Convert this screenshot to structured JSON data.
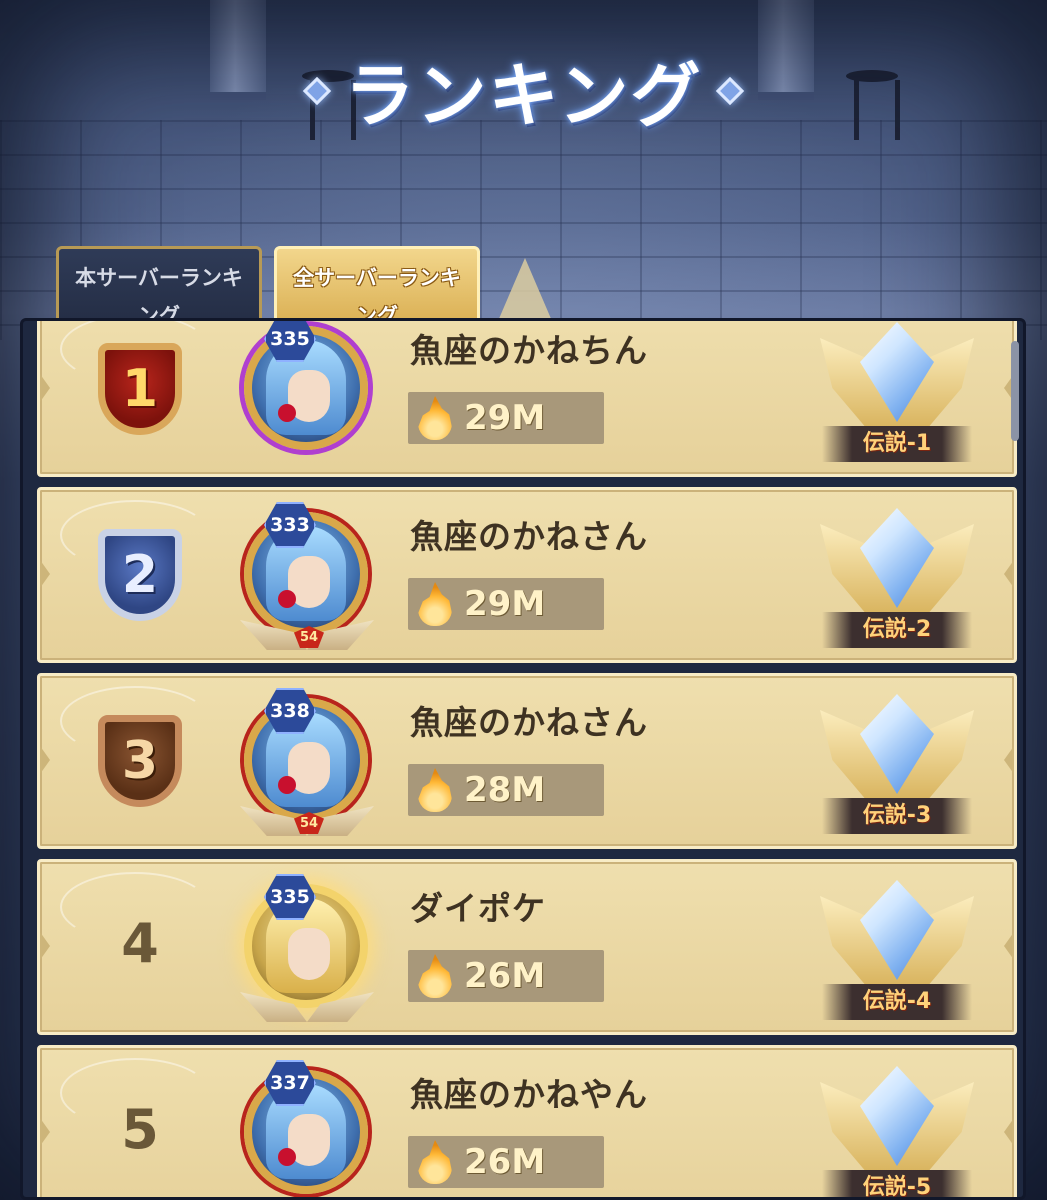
{
  "title": "ランキング",
  "tabs": [
    {
      "label": "本サーバーランキング",
      "active": false
    },
    {
      "label": "全サーバーランキング",
      "active": true
    }
  ],
  "rankings": [
    {
      "rank": "1",
      "level": "335",
      "name": "魚座のかねちん",
      "power": "29M",
      "tier": "伝説-1"
    },
    {
      "rank": "2",
      "level": "333",
      "name": "魚座のかねさん",
      "power": "29M",
      "tier": "伝説-2",
      "star": "54"
    },
    {
      "rank": "3",
      "level": "338",
      "name": "魚座のかねさん",
      "power": "28M",
      "tier": "伝説-3",
      "star": "54"
    },
    {
      "rank": "4",
      "level": "335",
      "name": "ダイポケ",
      "power": "26M",
      "tier": "伝説-4"
    },
    {
      "rank": "5",
      "level": "337",
      "name": "魚座のかねやん",
      "power": "26M",
      "tier": "伝説-5"
    }
  ],
  "colors": {
    "row_bg": "#e9d6a2",
    "gold_rank": "#b8251c",
    "silver_rank": "#3f5ca8",
    "bronze_rank": "#7a4524",
    "tier_text": "#ffd27a"
  },
  "icons": {
    "title_ornament": "diamond-icon",
    "power": "flame-icon",
    "tier": "legend-crystal-icon"
  }
}
